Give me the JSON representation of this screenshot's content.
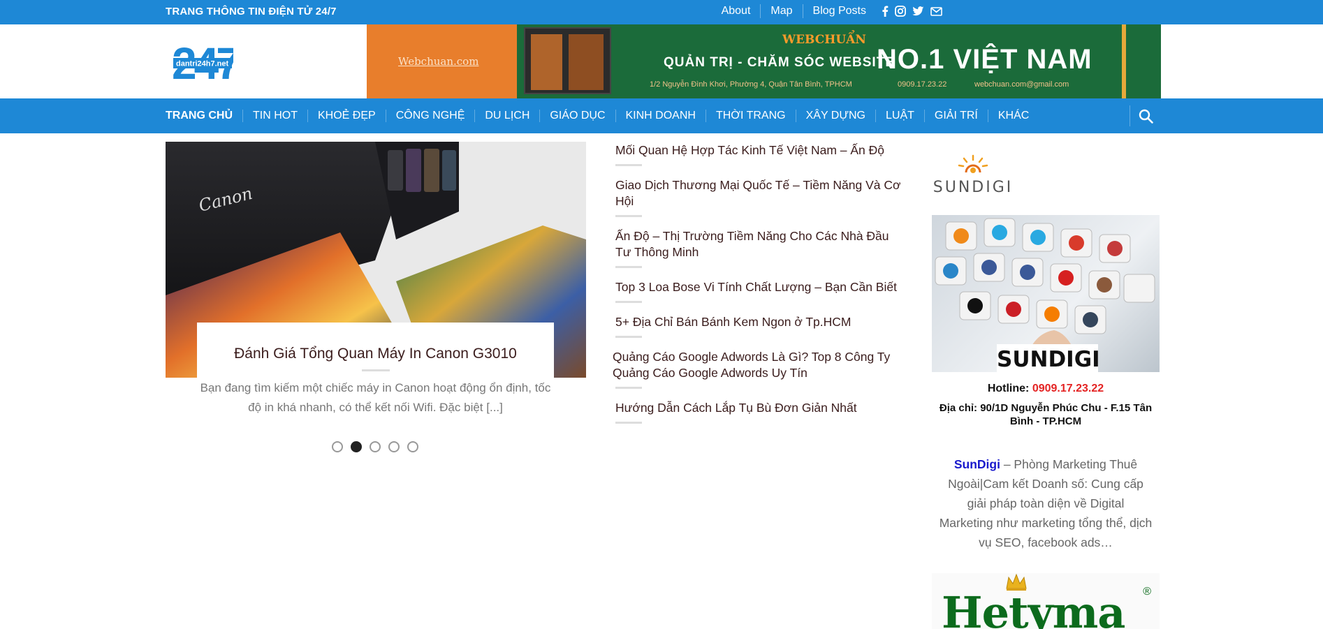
{
  "topbar": {
    "site_tag": "TRANG THÔNG TIN ĐIỆN TỬ 24/7",
    "links": [
      "About",
      "Map",
      "Blog Posts"
    ],
    "social_icons": [
      "facebook-icon",
      "instagram-icon",
      "twitter-icon",
      "email-icon"
    ]
  },
  "logo": {
    "number": "247",
    "domain": "dantri24h7.net"
  },
  "banner": {
    "left_text": "Webchuan.com",
    "brand": "WEBCHUẨN",
    "slogan": "QUẢN TRỊ - CHĂM SÓC WEBSITE",
    "big": "NO.1 VIỆT NAM",
    "address": "1/2 Nguyễn Đình Khơi, Phường 4, Quận Tân Bình, TPHCM",
    "phone": "0909.17.23.22",
    "email": "webchuan.com@gmail.com"
  },
  "nav": {
    "items": [
      "TRANG CHỦ",
      "TIN HOT",
      "KHOẺ ĐẸP",
      "CÔNG NGHỆ",
      "DU LỊCH",
      "GIÁO DỤC",
      "KINH DOANH",
      "THỜI TRANG",
      "XÂY DỰNG",
      "LUẬT",
      "GIẢI TRÍ",
      "KHÁC"
    ]
  },
  "slider": {
    "image_brand": "Canon",
    "title": "Đánh Giá Tổng Quan Máy In Canon G3010",
    "excerpt": "Bạn đang tìm kiếm một chiếc máy in Canon hoạt động ổn định, tốc độ in khá nhanh, có thể kết nối Wifi. Đặc biệt [...]",
    "dots": 5,
    "active_dot": 2
  },
  "posts": [
    "Mối Quan Hệ Hợp Tác Kinh Tế Việt Nam – Ấn Độ",
    "Giao Dịch Thương Mại Quốc Tế – Tiềm Năng Và Cơ Hội",
    "Ấn Độ – Thị Trường Tiềm Năng Cho Các Nhà Đầu Tư Thông Minh",
    "Top 3 Loa Bose Vi Tính Chất Lượng – Bạn Cần Biết",
    "5+ Địa Chỉ Bán Bánh Kem Ngon ở Tp.HCM",
    "Quảng Cáo Google Adwords Là Gì? Top 8 Công Ty Quảng Cáo Google Adwords Uy Tín",
    "Hướng Dẫn Cách Lắp Tụ Bù Đơn Giản Nhất"
  ],
  "sidebar": {
    "logo_word": "SUNDIGI",
    "label": "SUNDIGI",
    "hotline_label": "Hotline:",
    "hotline": "0909.17.23.22",
    "address": "Địa chỉ: 90/1D Nguyễn Phúc Chu - F.15 Tân Bình - TP.HCM",
    "desc_brand": "SunDigi",
    "desc_rest": " – Phòng Marketing Thuê Ngoài|Cam kết Doanh số: Cung cấp giải pháp toàn diện về Digital Marketing như marketing tổng thể, dịch vụ SEO, facebook ads…",
    "ad2_word": "Hetyma",
    "ad2_reg": "®"
  },
  "colors": {
    "primary": "#1e88d6",
    "title_text": "#3b1d1d",
    "hotline_red": "#e42424",
    "brand_link": "#1a1acc"
  }
}
